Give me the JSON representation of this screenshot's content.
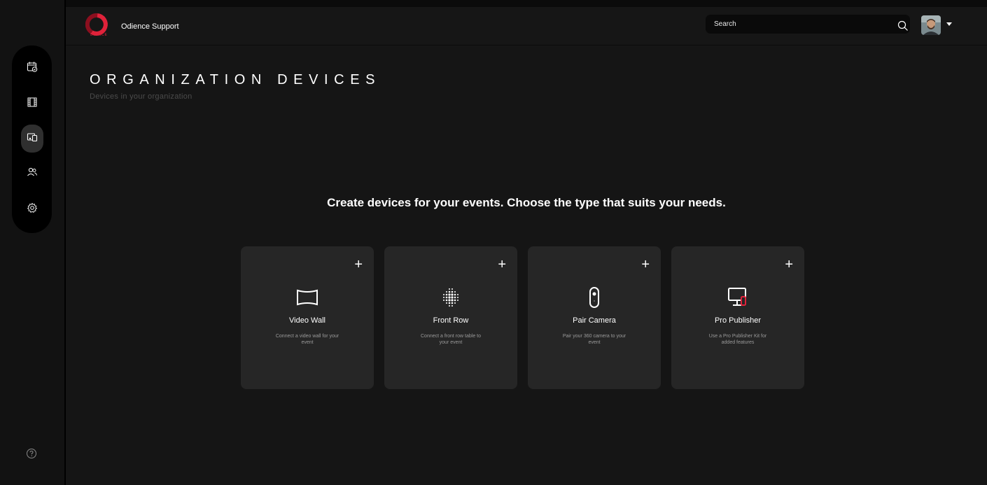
{
  "brand": {
    "logo_text": "DIENCE",
    "name": "Odience Support",
    "accent": "#e0223a"
  },
  "search": {
    "placeholder": "Search",
    "icon": "search-icon"
  },
  "user": {
    "avatar": "user-avatar",
    "menu_icon": "caret-down-icon"
  },
  "sidenav": {
    "items": [
      {
        "icon": "calendar-check-icon",
        "active": false
      },
      {
        "icon": "film-icon",
        "active": false
      },
      {
        "icon": "devices-icon",
        "active": true
      },
      {
        "icon": "users-icon",
        "active": false
      },
      {
        "icon": "settings-gear-icon",
        "active": false
      }
    ],
    "help_icon": "help-circle-icon"
  },
  "page": {
    "title": "ORGANIZATION DEVICES",
    "subtitle": "Devices in your organization",
    "headline": "Create devices for your events. Choose the type that suits your needs."
  },
  "cards": [
    {
      "title": "Video Wall",
      "description": "Connect a video wall for your event",
      "icon": "video-wall-icon",
      "add_label": "+"
    },
    {
      "title": "Front Row",
      "description": "Connect a front row table to your event",
      "icon": "front-row-icon",
      "add_label": "+"
    },
    {
      "title": "Pair Camera",
      "description": "Pair your 360 camera to your event",
      "icon": "camera-360-icon",
      "add_label": "+"
    },
    {
      "title": "Pro Publisher",
      "description": "Use a Pro Publisher Kit for added features",
      "icon": "pro-publisher-icon",
      "add_label": "+"
    }
  ]
}
